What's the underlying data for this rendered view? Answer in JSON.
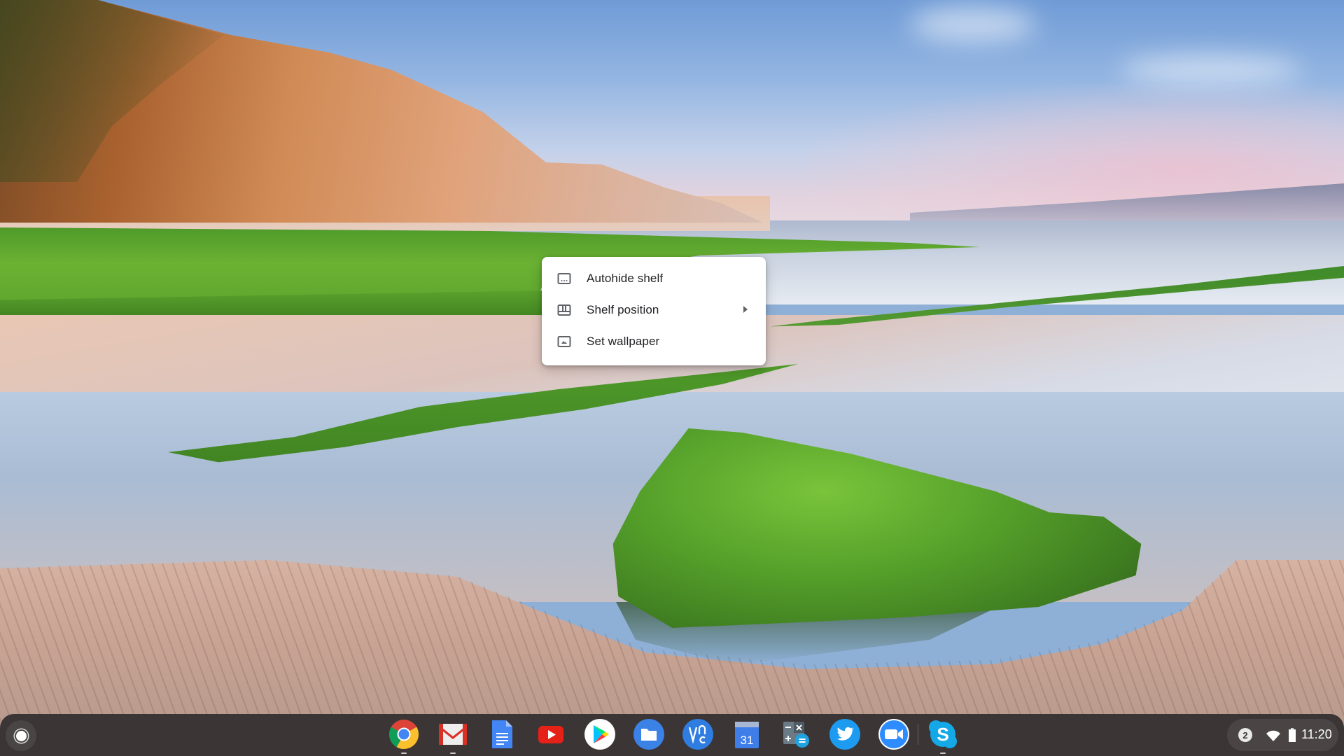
{
  "desktop": {
    "wallpaper": "coastal cliffs with moss-covered rock at low tide"
  },
  "context_menu": {
    "items": [
      {
        "label": "Autohide shelf",
        "icon": "autohide-shelf-icon",
        "has_submenu": false
      },
      {
        "label": "Shelf position",
        "icon": "shelf-position-icon",
        "has_submenu": true
      },
      {
        "label": "Set wallpaper",
        "icon": "wallpaper-icon",
        "has_submenu": false
      }
    ]
  },
  "shelf": {
    "launcher": {
      "icon": "launcher-icon"
    },
    "apps": [
      {
        "name": "Chrome",
        "icon": "chrome-icon",
        "running": true
      },
      {
        "name": "Gmail",
        "icon": "gmail-icon",
        "running": true
      },
      {
        "name": "Google Docs",
        "icon": "docs-icon",
        "running": false
      },
      {
        "name": "YouTube",
        "icon": "youtube-icon",
        "running": false
      },
      {
        "name": "Play Store",
        "icon": "play-store-icon",
        "running": false
      },
      {
        "name": "Files",
        "icon": "files-icon",
        "running": false
      },
      {
        "name": "VNC Viewer",
        "icon": "vnc-icon",
        "running": false
      },
      {
        "name": "Google Calendar",
        "icon": "calendar-icon",
        "running": false,
        "date": "31"
      },
      {
        "name": "Calculator",
        "icon": "calculator-icon",
        "running": false
      },
      {
        "name": "Twitter",
        "icon": "twitter-icon",
        "running": false
      },
      {
        "name": "Zoom",
        "icon": "zoom-icon",
        "running": false
      },
      {
        "name": "Skype",
        "icon": "skype-icon",
        "running": true,
        "letter": "S"
      }
    ]
  },
  "status_tray": {
    "notification_count": "2",
    "wifi": "wifi-icon",
    "battery": "battery-icon",
    "time": "11:20"
  },
  "colors": {
    "shelf_bg": "#3b3535",
    "tray_bg": "#4a4444",
    "menu_bg": "#ffffff",
    "menu_text": "#202124",
    "menu_icon": "#5f6368"
  }
}
